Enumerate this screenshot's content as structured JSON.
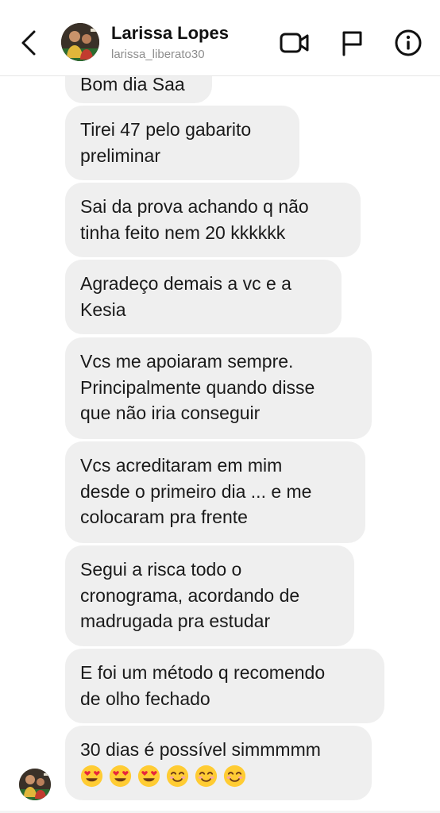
{
  "header": {
    "name": "Larissa Lopes",
    "handle": "larissa_liberato30"
  },
  "messages": [
    {
      "lines": [
        "Bom dia Saa"
      ]
    },
    {
      "lines": [
        "Tirei 47 pelo gabarito",
        "preliminar"
      ]
    },
    {
      "lines": [
        "Sai da prova achando q não",
        "tinha feito nem 20 kkkkkk"
      ]
    },
    {
      "lines": [
        "Agradeço demais a vc e a",
        "Kesia"
      ]
    },
    {
      "lines": [
        "Vcs me apoiaram sempre.",
        "Principalmente quando disse",
        "que não iria conseguir"
      ]
    },
    {
      "lines": [
        "Vcs acreditaram em mim",
        "desde o primeiro dia ... e me",
        "colocaram pra frente"
      ]
    },
    {
      "lines": [
        "Segui a risca todo o",
        "cronograma, acordando de",
        "madrugada pra estudar"
      ]
    },
    {
      "lines": [
        "E foi um método q recomendo",
        "de olho fechado"
      ]
    },
    {
      "lines": [
        "30 dias é possível simmmmm"
      ]
    }
  ],
  "last_message_emojis": [
    "heart-eyes",
    "heart-eyes",
    "heart-eyes",
    "smiling-face",
    "smiling-face",
    "smiling-face"
  ],
  "colors": {
    "bubble": "#efefef",
    "handle": "#8e8e8e",
    "emoji": "#ffcc33"
  }
}
